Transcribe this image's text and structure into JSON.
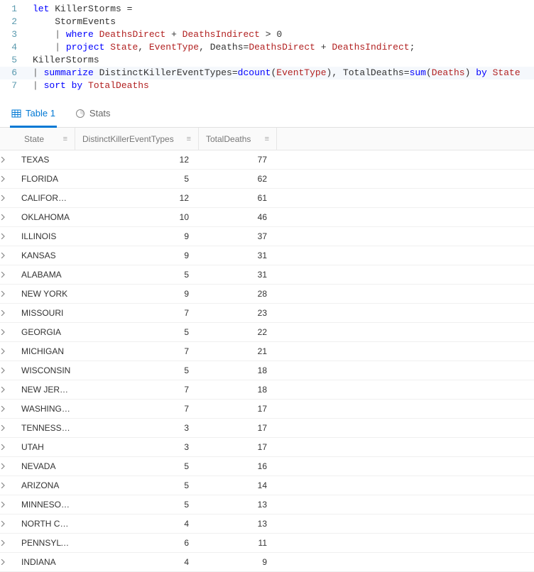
{
  "editor": {
    "lines": [
      {
        "n": "1",
        "segments": [
          {
            "t": "let ",
            "c": "kw"
          },
          {
            "t": "KillerStorms ",
            "c": "ident"
          },
          {
            "t": "=",
            "c": "op"
          }
        ]
      },
      {
        "n": "2",
        "segments": [
          {
            "t": "    ",
            "c": "ident"
          },
          {
            "t": "StormEvents",
            "c": "ident"
          }
        ]
      },
      {
        "n": "3",
        "segments": [
          {
            "t": "    ",
            "c": "ident"
          },
          {
            "t": "| ",
            "c": "pipe"
          },
          {
            "t": "where ",
            "c": "func"
          },
          {
            "t": "DeathsDirect ",
            "c": "col"
          },
          {
            "t": "+ ",
            "c": "op"
          },
          {
            "t": "DeathsIndirect ",
            "c": "col"
          },
          {
            "t": "> ",
            "c": "op"
          },
          {
            "t": "0",
            "c": "num"
          }
        ]
      },
      {
        "n": "4",
        "segments": [
          {
            "t": "    ",
            "c": "ident"
          },
          {
            "t": "| ",
            "c": "pipe"
          },
          {
            "t": "project ",
            "c": "func"
          },
          {
            "t": "State",
            "c": "col"
          },
          {
            "t": ", ",
            "c": "op"
          },
          {
            "t": "EventType",
            "c": "col"
          },
          {
            "t": ", ",
            "c": "op"
          },
          {
            "t": "Deaths",
            "c": "ident"
          },
          {
            "t": "=",
            "c": "op"
          },
          {
            "t": "DeathsDirect ",
            "c": "col"
          },
          {
            "t": "+ ",
            "c": "op"
          },
          {
            "t": "DeathsIndirect",
            "c": "col"
          },
          {
            "t": ";",
            "c": "op"
          }
        ]
      },
      {
        "n": "5",
        "segments": [
          {
            "t": "KillerStorms",
            "c": "ident"
          }
        ]
      },
      {
        "n": "6",
        "segments": [
          {
            "t": "| ",
            "c": "pipe"
          },
          {
            "t": "summarize ",
            "c": "func"
          },
          {
            "t": "DistinctKillerEventTypes",
            "c": "ident"
          },
          {
            "t": "=",
            "c": "op"
          },
          {
            "t": "dcount",
            "c": "call"
          },
          {
            "t": "(",
            "c": "op"
          },
          {
            "t": "EventType",
            "c": "col"
          },
          {
            "t": "), ",
            "c": "op"
          },
          {
            "t": "TotalDeaths",
            "c": "ident"
          },
          {
            "t": "=",
            "c": "op"
          },
          {
            "t": "sum",
            "c": "call"
          },
          {
            "t": "(",
            "c": "op"
          },
          {
            "t": "Deaths",
            "c": "col"
          },
          {
            "t": ") ",
            "c": "op"
          },
          {
            "t": "by ",
            "c": "func"
          },
          {
            "t": "State",
            "c": "col"
          }
        ]
      },
      {
        "n": "7",
        "segments": [
          {
            "t": "| ",
            "c": "pipe"
          },
          {
            "t": "sort ",
            "c": "func"
          },
          {
            "t": "by ",
            "c": "func"
          },
          {
            "t": "TotalDeaths",
            "c": "col"
          }
        ]
      }
    ]
  },
  "tabs": {
    "table_label": "Table 1",
    "stats_label": "Stats"
  },
  "table": {
    "columns": {
      "state": "State",
      "types": "DistinctKillerEventTypes",
      "deaths": "TotalDeaths"
    },
    "rows": [
      {
        "state": "TEXAS",
        "types": "12",
        "deaths": "77"
      },
      {
        "state": "FLORIDA",
        "types": "5",
        "deaths": "62"
      },
      {
        "state": "CALIFORNIA",
        "types": "12",
        "deaths": "61"
      },
      {
        "state": "OKLAHOMA",
        "types": "10",
        "deaths": "46"
      },
      {
        "state": "ILLINOIS",
        "types": "9",
        "deaths": "37"
      },
      {
        "state": "KANSAS",
        "types": "9",
        "deaths": "31"
      },
      {
        "state": "ALABAMA",
        "types": "5",
        "deaths": "31"
      },
      {
        "state": "NEW YORK",
        "types": "9",
        "deaths": "28"
      },
      {
        "state": "MISSOURI",
        "types": "7",
        "deaths": "23"
      },
      {
        "state": "GEORGIA",
        "types": "5",
        "deaths": "22"
      },
      {
        "state": "MICHIGAN",
        "types": "7",
        "deaths": "21"
      },
      {
        "state": "WISCONSIN",
        "types": "5",
        "deaths": "18"
      },
      {
        "state": "NEW JERSEY",
        "types": "7",
        "deaths": "18"
      },
      {
        "state": "WASHINGT…",
        "types": "7",
        "deaths": "17"
      },
      {
        "state": "TENNESSEE",
        "types": "3",
        "deaths": "17"
      },
      {
        "state": "UTAH",
        "types": "3",
        "deaths": "17"
      },
      {
        "state": "NEVADA",
        "types": "5",
        "deaths": "16"
      },
      {
        "state": "ARIZONA",
        "types": "5",
        "deaths": "14"
      },
      {
        "state": "MINNESOTA",
        "types": "5",
        "deaths": "13"
      },
      {
        "state": "NORTH CA…",
        "types": "4",
        "deaths": "13"
      },
      {
        "state": "PENNSYLV…",
        "types": "6",
        "deaths": "11"
      },
      {
        "state": "INDIANA",
        "types": "4",
        "deaths": "9"
      }
    ]
  }
}
